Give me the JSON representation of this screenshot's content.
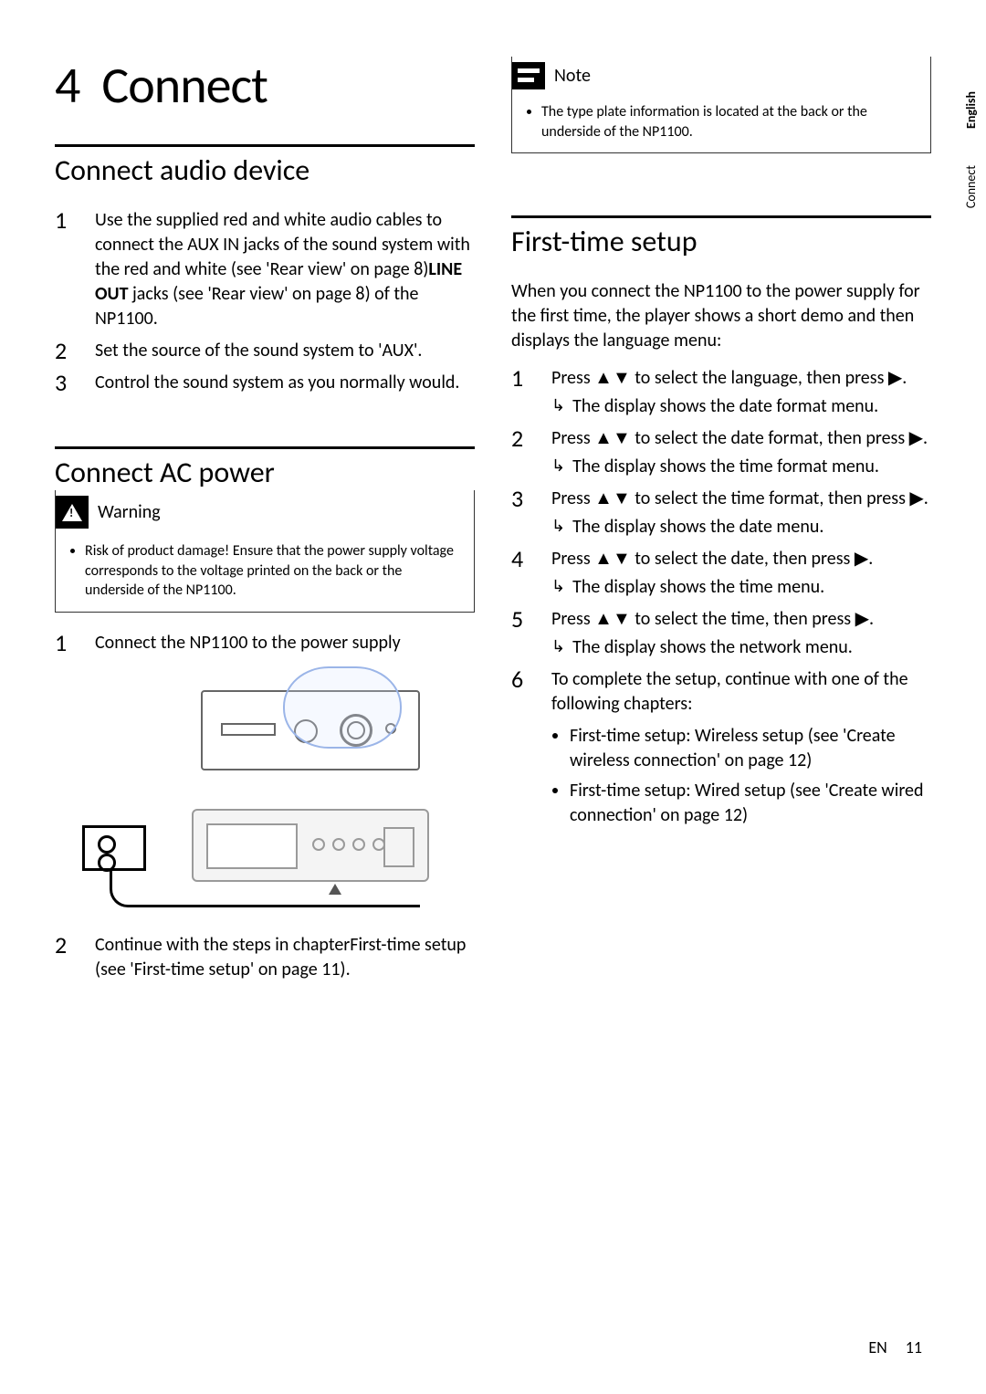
{
  "chapter": {
    "number": "4",
    "title": "Connect"
  },
  "sideTabs": {
    "language": "English",
    "section": "Connect"
  },
  "left": {
    "s1": {
      "heading": "Connect audio device",
      "steps": [
        {
          "num": "1",
          "pre": "Use the supplied red and white audio cables to connect the AUX IN jacks of the sound system with the red and white  (see 'Rear view' on page 8)",
          "bold": "LINE OUT",
          "post": " jacks (see 'Rear view' on page 8) of the NP1100."
        },
        {
          "num": "2",
          "text": "Set the source of the sound system to 'AUX'."
        },
        {
          "num": "3",
          "text": "Control the sound system as you normally would."
        }
      ]
    },
    "s2": {
      "heading": "Connect AC power",
      "warning": {
        "label": "Warning",
        "text": "Risk of product damage! Ensure that the power supply voltage corresponds to the voltage printed on the back or the underside of the NP1100."
      },
      "steps": [
        {
          "num": "1",
          "text": "Connect the NP1100 to the power supply"
        },
        {
          "num": "2",
          "pre": "Continue with the steps in chapter",
          "ital": "First-time setup",
          "post": " (see 'First-time setup' on page 11)."
        }
      ]
    }
  },
  "right": {
    "note": {
      "label": "Note",
      "text": "The type plate information is located at the back or the underside of the NP1100."
    },
    "s3": {
      "heading": "First-time setup",
      "intro": "When you connect the NP1100 to the power supply for the first time, the player shows a short demo and then displays the language menu:",
      "steps": [
        {
          "num": "1",
          "text": "Press ▲▼ to select the language, then press ▶.",
          "result": "The display shows the date format menu."
        },
        {
          "num": "2",
          "text": "Press ▲▼ to select the date format, then press ▶.",
          "result": "The display shows the time format menu."
        },
        {
          "num": "3",
          "text": "Press ▲▼ to select the time format, then press ▶.",
          "result": "The display shows the date menu."
        },
        {
          "num": "4",
          "text": "Press ▲▼ to select the date, then press ▶.",
          "result": "The display shows the time menu."
        },
        {
          "num": "5",
          "text": "Press ▲▼ to select the time, then press ▶.",
          "result": "The display shows the network menu."
        },
        {
          "num": "6",
          "text": "To complete the setup, continue with one of the following chapters:"
        }
      ],
      "bullets": [
        "First-time setup: Wireless setup (see 'Create wireless connection' on page 12)",
        "First-time setup: Wired setup (see 'Create wired connection' on page 12)"
      ]
    }
  },
  "footer": {
    "lang": "EN",
    "page": "11"
  }
}
